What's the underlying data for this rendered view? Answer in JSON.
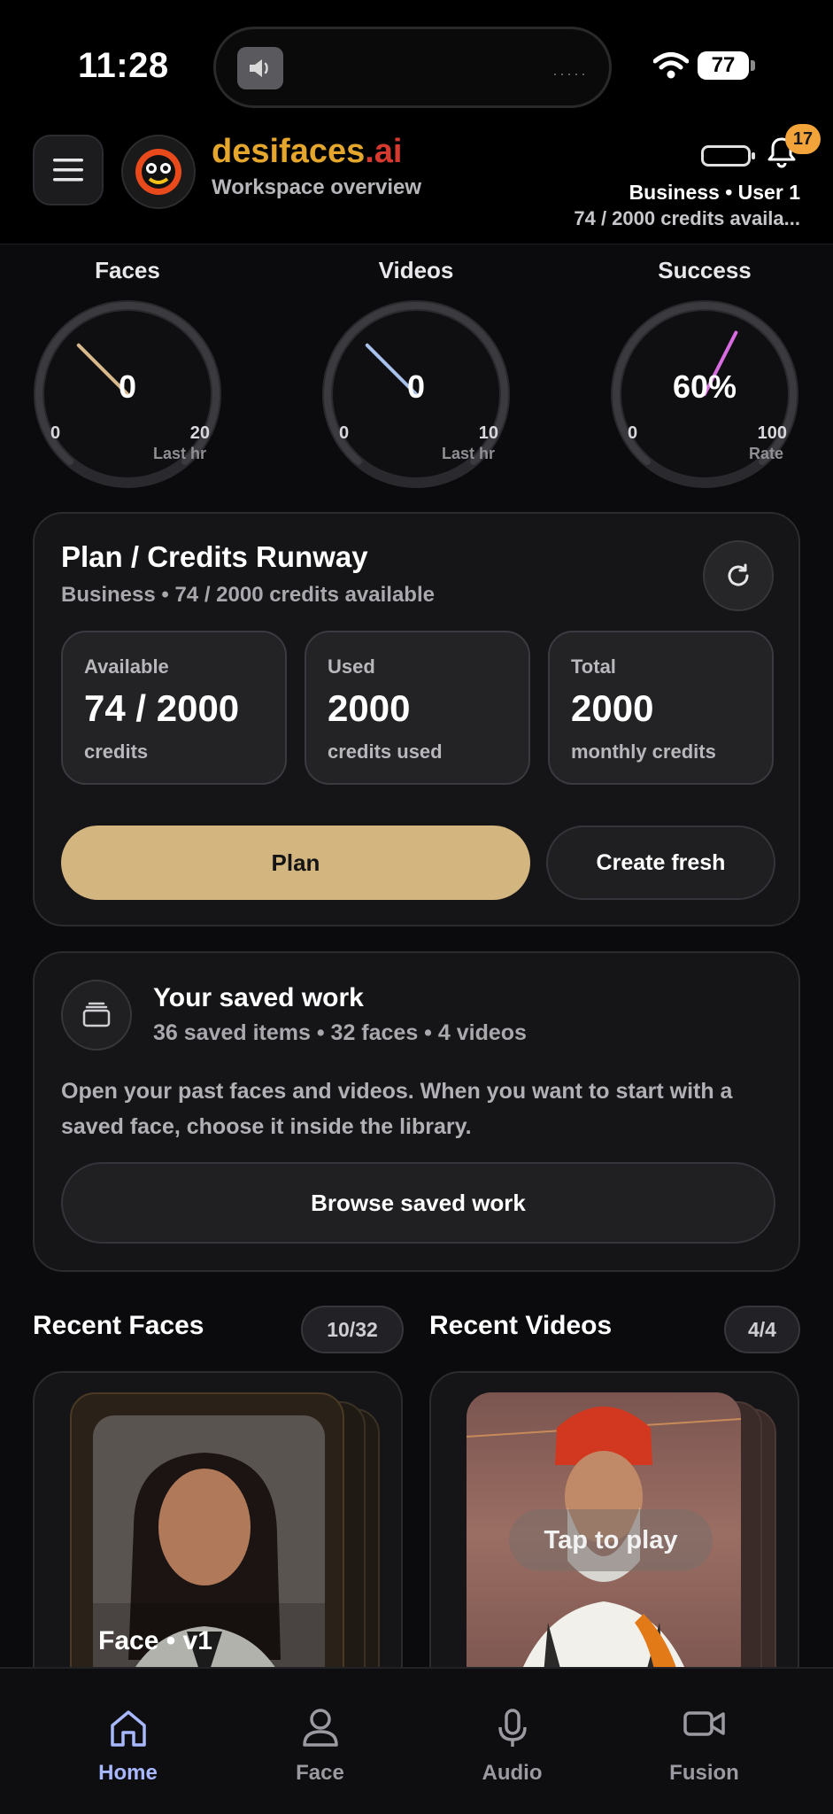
{
  "status_bar": {
    "time": "11:28",
    "battery": "77"
  },
  "header": {
    "brand_part1": "desifaces",
    "brand_part2": ".ai",
    "subtitle": "Workspace overview",
    "notification_count": "17",
    "account": "Business • User 1",
    "credits": "74 / 2000 credits availa..."
  },
  "gauges": [
    {
      "title": "Faces",
      "value": "0",
      "min": "0",
      "max": "20",
      "caption": "Last hr",
      "needle_color": "#d9b98c",
      "level": 0
    },
    {
      "title": "Videos",
      "value": "0",
      "min": "0",
      "max": "10",
      "caption": "Last hr",
      "needle_color": "#a9c1ea",
      "level": 0
    },
    {
      "title": "Success",
      "value": "60%",
      "min": "0",
      "max": "100",
      "caption": "Rate",
      "needle_color": "#d96be0",
      "level": 0.6
    }
  ],
  "plan": {
    "title": "Plan / Credits Runway",
    "subtitle": "Business • 74 / 2000 credits available",
    "stats": [
      {
        "label": "Available",
        "value": "74 / 2000",
        "note": "credits"
      },
      {
        "label": "Used",
        "value": "2000",
        "note": "credits used"
      },
      {
        "label": "Total",
        "value": "2000",
        "note": "monthly credits"
      }
    ],
    "primary_button": "Plan",
    "secondary_button": "Create fresh"
  },
  "saved": {
    "title": "Your saved work",
    "subtitle": "36 saved items • 32 faces • 4 videos",
    "description": "Open your past faces and videos. When you want to start with a saved face, choose it inside the library.",
    "button": "Browse saved work"
  },
  "recent_faces": {
    "title": "Recent Faces",
    "count": "10/32",
    "item_label": "Face • v1"
  },
  "recent_videos": {
    "title": "Recent Videos",
    "count": "4/4",
    "overlay": "Tap to play"
  },
  "nav": [
    {
      "label": "Home",
      "icon": "home-icon",
      "active": true
    },
    {
      "label": "Face",
      "icon": "person-icon",
      "active": false
    },
    {
      "label": "Audio",
      "icon": "microphone-icon",
      "active": false
    },
    {
      "label": "Fusion",
      "icon": "video-camera-icon",
      "active": false
    }
  ],
  "colors": {
    "accent": "#d3b57f",
    "brand_orange": "#e4a62c",
    "brand_red": "#d63a2f",
    "nav_active": "#a8b8ff"
  }
}
